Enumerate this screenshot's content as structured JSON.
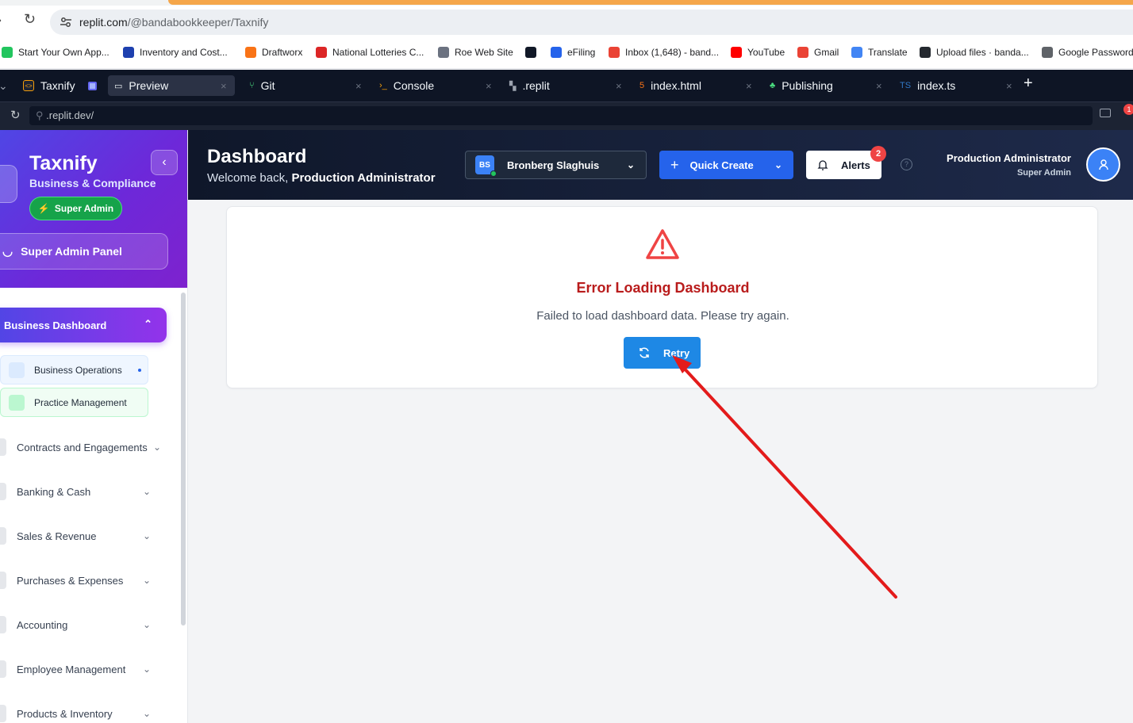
{
  "browser": {
    "url_host": "replit.com",
    "url_path": "/@bandabookkeeper/Taxnify",
    "bookmarks": [
      {
        "label": "Start Your Own App...",
        "color": "#22c55e"
      },
      {
        "label": "Inventory and Cost...",
        "color": "#1e40af"
      },
      {
        "label": "Draftworx",
        "color": "#f97316"
      },
      {
        "label": "National Lotteries C...",
        "color": "#dc2626"
      },
      {
        "label": "Roe Web Site",
        "color": "#6b7280"
      },
      {
        "label": "",
        "color": "#111827"
      },
      {
        "label": "eFiling",
        "color": "#2563eb"
      },
      {
        "label": "Inbox (1,648) - band...",
        "color": "#ea4335"
      },
      {
        "label": "YouTube",
        "color": "#ff0000"
      },
      {
        "label": "Gmail",
        "color": "#ea4335"
      },
      {
        "label": "Translate",
        "color": "#4285f4"
      },
      {
        "label": "Upload files · banda...",
        "color": "#24292f"
      },
      {
        "label": "Google Password",
        "color": "#5f6368"
      }
    ]
  },
  "replit": {
    "project": "Taxnify",
    "tabs": [
      {
        "label": "Preview"
      },
      {
        "label": "Git"
      },
      {
        "label": "Console"
      },
      {
        "label": ".replit"
      },
      {
        "label": "index.html"
      },
      {
        "label": "Publishing"
      },
      {
        "label": "index.ts"
      }
    ],
    "preview_url": ".replit.dev/",
    "notification_count": "1"
  },
  "sidebar": {
    "brand": "Taxnify",
    "subtitle": "Business & Compliance",
    "badge": "Super Admin",
    "panel_button": "Super Admin Panel",
    "active_section": "Business Dashboard",
    "sub_items": [
      {
        "label": "Business Operations",
        "color": "#dbeafe",
        "bg": "#eff6ff",
        "border": "#dbeafe"
      },
      {
        "label": "Practice Management",
        "color": "#bbf7d0",
        "bg": "#f0fdf4",
        "border": "#bbf7d0"
      }
    ],
    "items": [
      {
        "label": "Contracts and Engagements"
      },
      {
        "label": "Banking & Cash"
      },
      {
        "label": "Sales & Revenue"
      },
      {
        "label": "Purchases & Expenses"
      },
      {
        "label": "Accounting"
      },
      {
        "label": "Employee Management"
      },
      {
        "label": "Products & Inventory"
      }
    ]
  },
  "header": {
    "title": "Dashboard",
    "welcome_prefix": "Welcome back, ",
    "welcome_name": "Production Administrator",
    "company_initials": "BS",
    "company_name": "Bronberg Slaghuis",
    "quick_create": "Quick Create",
    "alerts": "Alerts",
    "alerts_count": "2",
    "user_name": "Production Administrator",
    "user_role": "Super Admin"
  },
  "error": {
    "title": "Error Loading Dashboard",
    "message": "Failed to load dashboard data. Please try again.",
    "retry": "Retry"
  },
  "colors": {
    "accent_blue": "#1e88e5",
    "error_red": "#b91c1c",
    "annotation_arrow": "#e31b1b"
  }
}
